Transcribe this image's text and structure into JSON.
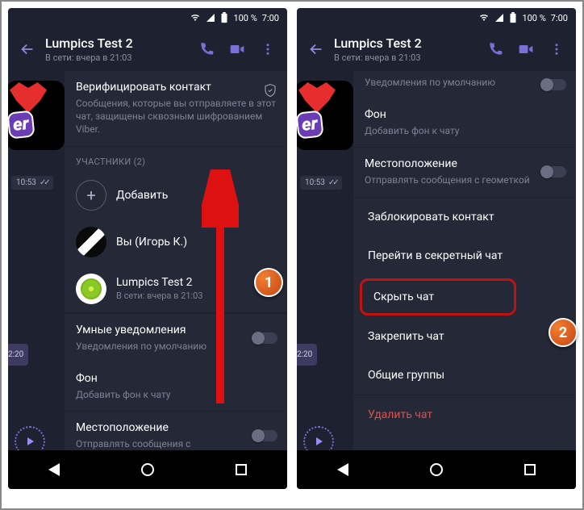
{
  "status": {
    "battery": "100 %",
    "time": "7:00"
  },
  "header": {
    "title": "Lumpics Test 2",
    "subtitle": "В сети: вчера в 21:03"
  },
  "left_panel": {
    "verify": {
      "title": "Верифицировать контакт",
      "desc": "Сообщения, которые вы отправляете в этот чат, защищены сквозным шифрованием Viber."
    },
    "participants_header": "УЧАСТНИКИ (2)",
    "add_label": "Добавить",
    "you_label": "Вы (Игорь К.)",
    "contact_name": "Lumpics Test 2",
    "contact_meta": "В сети: вчера в 21:03",
    "smart": {
      "title": "Умные уведомления",
      "sub": "Уведомления по умолчанию"
    },
    "bg": {
      "title": "Фон",
      "sub": "Добавить фон к чату"
    },
    "loc": {
      "title": "Местоположение",
      "sub": "Отправлять сообщения с"
    },
    "time1": "10:53",
    "time2": "2:20"
  },
  "right_panel": {
    "notif_sub": "Уведомления по умолчанию",
    "bg": {
      "title": "Фон",
      "sub": "Добавить фон к чату"
    },
    "loc": {
      "title": "Местоположение",
      "sub": "Отправлять сообщения с геометкой"
    },
    "block": "Заблокировать контакт",
    "secret": "Перейти в секретный чат",
    "hide": "Скрыть чат",
    "pin": "Закрепить чат",
    "groups": "Общие группы",
    "delete": "Удалить чат",
    "time1": "10:53",
    "time2": "2:20"
  },
  "badges": {
    "one": "1",
    "two": "2"
  }
}
